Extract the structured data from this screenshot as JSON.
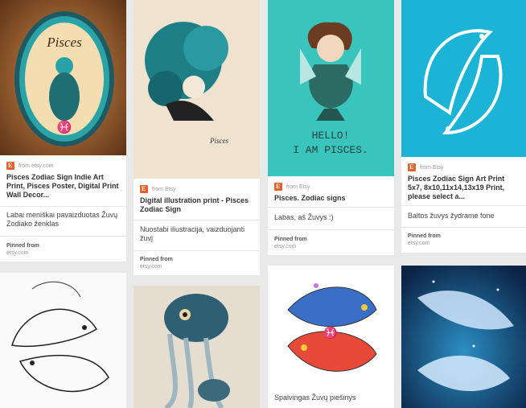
{
  "pins": [
    {
      "source": "from etsy.com",
      "title": "Pisces Zodiac Sign Indie Art Print, Pisces Poster, Digital Print Wall Decor...",
      "description": "Labai meniškai pavaizduotas Žuvų Zodiako ženklas",
      "pinned_from": "Pinned from",
      "site": "etsy.com",
      "art_text": "Pisces",
      "symbol": "♓"
    },
    {
      "source": "from Etsy",
      "title": "Digital illustration print - Pisces Zodiac Sign",
      "description": "Nuostabi iliustracija, vaizduojanti žuvį",
      "pinned_from": "Pinned from",
      "site": "etsy.com",
      "art_text": "Pisces"
    },
    {
      "source": "from Etsy",
      "title": "Pisces. Zodiac signs",
      "description": "Labas, aš Žuvys :)",
      "pinned_from": "Pinned from",
      "site": "etsy.com",
      "art_text_1": "HELLO!",
      "art_text_2": "I AM PISCES.",
      "art_text_3": "Pisces"
    },
    {
      "source": "from Etsy",
      "title": "Pisces Zodiac Sign Art Print 5x7, 8x10,11x14,13x19 Print, please select a...",
      "description": "Baltos žuvys žydrame fone",
      "pinned_from": "Pinned from",
      "site": "etsy.com"
    },
    {
      "description": "Spalvingas Žuvų piešinys",
      "symbol": "♓"
    }
  ],
  "colors": {
    "teal": "#2bbfb7",
    "dark_teal": "#1d6f78",
    "cyan_bg": "#1ab6d8",
    "brown": "#6b3a1f",
    "favicon": "#e1622b"
  }
}
